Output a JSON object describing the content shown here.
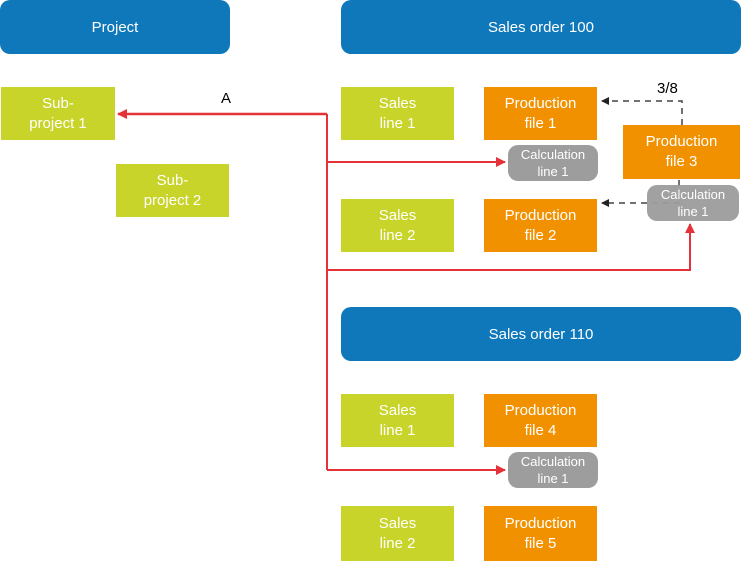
{
  "headers": {
    "project": "Project",
    "sales_order_100": "Sales order 100",
    "sales_order_110": "Sales order 110"
  },
  "subprojects": [
    "Sub-\nproject 1",
    "Sub-\nproject 2"
  ],
  "sales_order_100": {
    "sales_lines": [
      "Sales\nline 1",
      "Sales\nline 2"
    ],
    "production_files": [
      "Production\nfile 1",
      "Production\nfile 2",
      "Production\nfile 3"
    ],
    "calculation_lines": [
      "Calculation\nline 1",
      "Calculation\nline 1"
    ]
  },
  "sales_order_110": {
    "sales_lines": [
      "Sales\nline 1",
      "Sales\nline 2"
    ],
    "production_files": [
      "Production\nfile 4",
      "Production\nfile 5"
    ],
    "calculation_lines": [
      "Calculation\nline 1"
    ]
  },
  "labels": {
    "arrow_a": "A",
    "fraction": "3/8"
  },
  "colors": {
    "header": "#0e78bb",
    "subproject": "#c8d42a",
    "production": "#f29100",
    "calculation": "#9d9d9d",
    "connector": "#e53238"
  }
}
